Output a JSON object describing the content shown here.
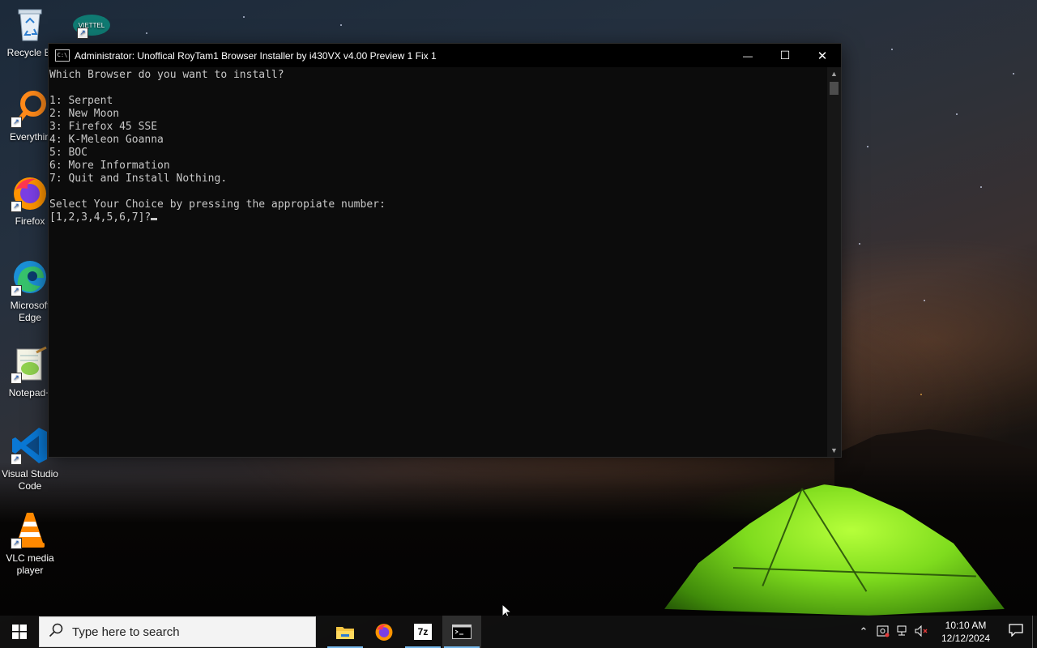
{
  "desktop": {
    "icons": [
      {
        "label": "Recycle Bi",
        "icon": "recycle-bin-icon"
      },
      {
        "label": "Everythin",
        "icon": "everything-search-icon"
      },
      {
        "label": "Firefox",
        "icon": "firefox-icon"
      },
      {
        "label": "Microsoft Edge",
        "icon": "edge-icon"
      },
      {
        "label": "Notepad+",
        "icon": "notepad-plus-plus-icon"
      },
      {
        "label": "Visual Studio Code",
        "icon": "vscode-icon"
      },
      {
        "label": "VLC media player",
        "icon": "vlc-icon"
      }
    ],
    "extra_icon_label": "VIETTEL"
  },
  "window": {
    "title": "Administrator:  Unoffical RoyTam1 Browser Installer by i430VX v4.00 Preview 1 Fix 1",
    "controls": {
      "minimize": "—",
      "maximize": "☐",
      "close": "✕"
    },
    "console_lines": [
      "Which Browser do you want to install?",
      "",
      "1: Serpent",
      "2: New Moon",
      "3: Firefox 45 SSE",
      "4: K-Meleon Goanna",
      "5: BOC",
      "6: More Information",
      "7: Quit and Install Nothing.",
      "",
      "Select Your Choice by pressing the appropiate number:"
    ],
    "prompt": "[1,2,3,4,5,6,7]?"
  },
  "taskbar": {
    "search_placeholder": "Type here to search",
    "apps": [
      {
        "name": "file-explorer-icon",
        "active": false
      },
      {
        "name": "firefox-icon",
        "active": false
      },
      {
        "name": "7zip-icon",
        "label": "7z",
        "active": false
      },
      {
        "name": "terminal-icon",
        "active": true
      }
    ],
    "clock": {
      "time": "10:10 AM",
      "date": "12/12/2024"
    }
  }
}
